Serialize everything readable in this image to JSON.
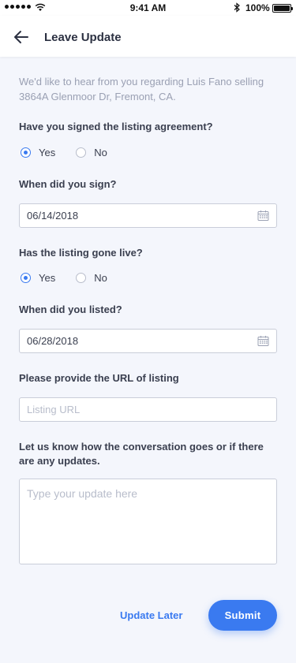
{
  "status_bar": {
    "time": "9:41 AM",
    "battery": "100%"
  },
  "header": {
    "title": "Leave Update"
  },
  "intro": "We'd like to hear from you regarding Luis Fano selling 3864A Glenmoor Dr, Fremont, CA.",
  "q1": {
    "label": "Have you signed the listing agreement?",
    "options": [
      "Yes",
      "No"
    ],
    "selected": "Yes"
  },
  "sign_date": {
    "label": "When did you sign?",
    "value": "06/14/2018"
  },
  "q2": {
    "label": "Has the listing gone live?",
    "options": [
      "Yes",
      "No"
    ],
    "selected": "Yes"
  },
  "listed_date": {
    "label": "When did you listed?",
    "value": "06/28/2018"
  },
  "url": {
    "label": "Please provide the URL of listing",
    "placeholder": "Listing URL"
  },
  "update": {
    "label": "Let us know how the conversation goes or if there are any updates.",
    "placeholder": "Type your update here"
  },
  "actions": {
    "later": "Update Later",
    "submit": "Submit"
  },
  "colors": {
    "accent": "#3a7af0",
    "background": "#f4f6fc"
  },
  "icons": {
    "back": "arrow-left-icon",
    "calendar": "calendar-icon"
  }
}
